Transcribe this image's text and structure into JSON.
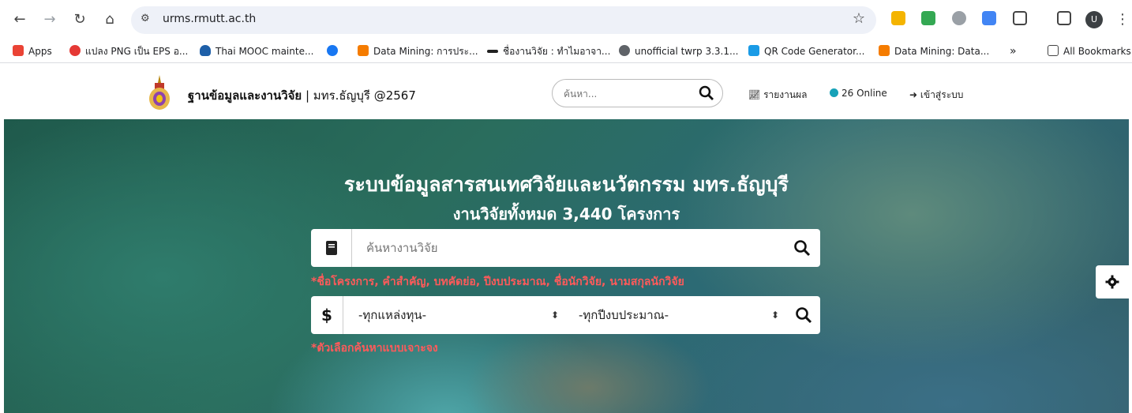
{
  "browser": {
    "url": "urms.rmutt.ac.th",
    "avatar_letter": "U"
  },
  "bookmarks": [
    {
      "label": "Apps",
      "icon": "apps-grid-icon",
      "color": "#ea4335"
    },
    {
      "label": "แปลง PNG เป็น EPS อ...",
      "icon": "convert-icon",
      "color": "#e53935"
    },
    {
      "label": "Thai MOOC mainte...",
      "icon": "mooc-icon",
      "color": "#1e5fa8"
    },
    {
      "label": "",
      "icon": "facebook-icon",
      "color": "#1877f2"
    },
    {
      "label": "Data Mining: การประ...",
      "icon": "blogger-icon",
      "color": "#f57c00"
    },
    {
      "label": "ชื่องานวิจัย : ทำไมอาจา...",
      "icon": "dots-icon",
      "color": "#222222"
    },
    {
      "label": "unofficial twrp 3.3.1...",
      "icon": "globe-icon",
      "color": "#5f6368"
    },
    {
      "label": "QR Code Generator...",
      "icon": "qr-icon",
      "color": "#1a9be6"
    },
    {
      "label": "Data Mining: Data...",
      "icon": "blogger-icon",
      "color": "#f57c00"
    }
  ],
  "bookmarks_all": "All Bookmarks",
  "site": {
    "title_bold": "ฐานข้อมูลและงานวิจัย",
    "title_rest": " | มทร.ธัญบุรี @2567",
    "search_placeholder": "ค้นหา...",
    "report_link": "รายงานผล",
    "online": "26 Online",
    "login_link": "เข้าสู่ระบบ"
  },
  "hero": {
    "title": "ระบบข้อมูลสารสนเทศวิจัยและนวัตกรรม มทร.ธัญบุรี",
    "subtitle": "งานวิจัยทั้งหมด 3,440 โครงการ",
    "search_placeholder": "ค้นหางานวิจัย",
    "search_hint": "*ชื่อโครงการ, คำสำคัญ, บทคัดย่อ, ปีงบประมาณ, ชื่อนักวิจัย, นามสกุลนักวิจัย",
    "currency_symbol": "$",
    "fund_select": "-ทุกแหล่งทุน-",
    "year_select": "-ทุกปีงบประมาณ-",
    "filter_hint": "*ตัวเลือกค้นหาแบบเจาะจง"
  }
}
